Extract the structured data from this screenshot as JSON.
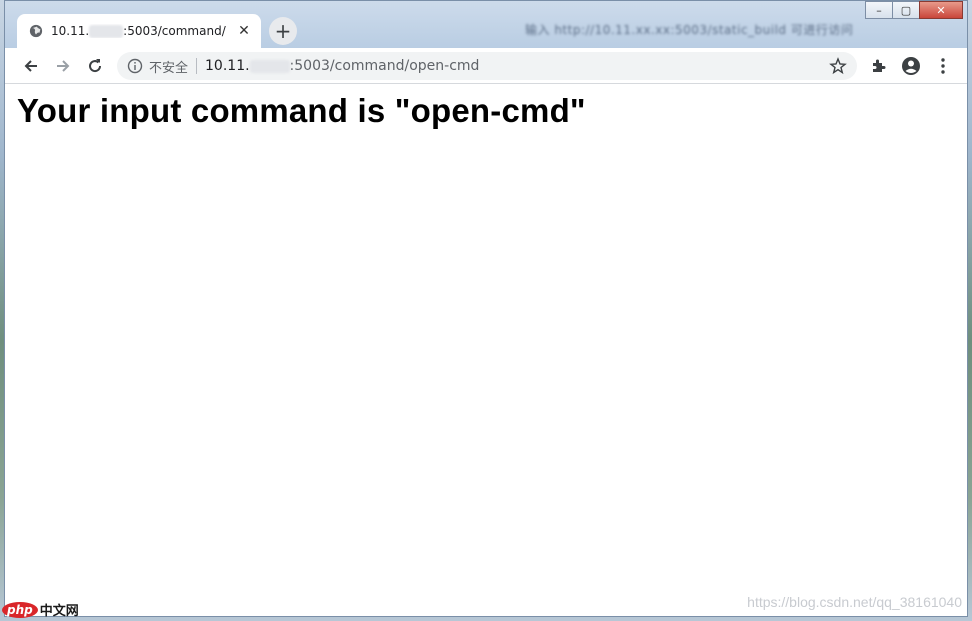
{
  "browser": {
    "tab": {
      "title_prefix": "10.11.",
      "title_suffix": ":5003/command/",
      "close_icon": "close-icon"
    },
    "new_tab_label": "+",
    "background_window_text": "输入 http://10.11.xx.xx:5003/static_build 可进行访问",
    "window_controls": {
      "minimize": "–",
      "maximize": "▢",
      "close": "✕"
    },
    "security_label": "不安全",
    "url": {
      "host_prefix": "10.11.",
      "host_suffix": ":5003",
      "path": "/command/open-cmd"
    }
  },
  "page": {
    "heading": "Your input command is \"open-cmd\""
  },
  "watermarks": {
    "left_logo": "php",
    "left_text": "中文网",
    "right_text": "https://blog.csdn.net/qq_38161040"
  },
  "colors": {
    "close_button": "#c9463a",
    "page_background": "#ffffff",
    "toolbar_background": "#ffffff",
    "titlebar_background": "#cddbeb"
  }
}
